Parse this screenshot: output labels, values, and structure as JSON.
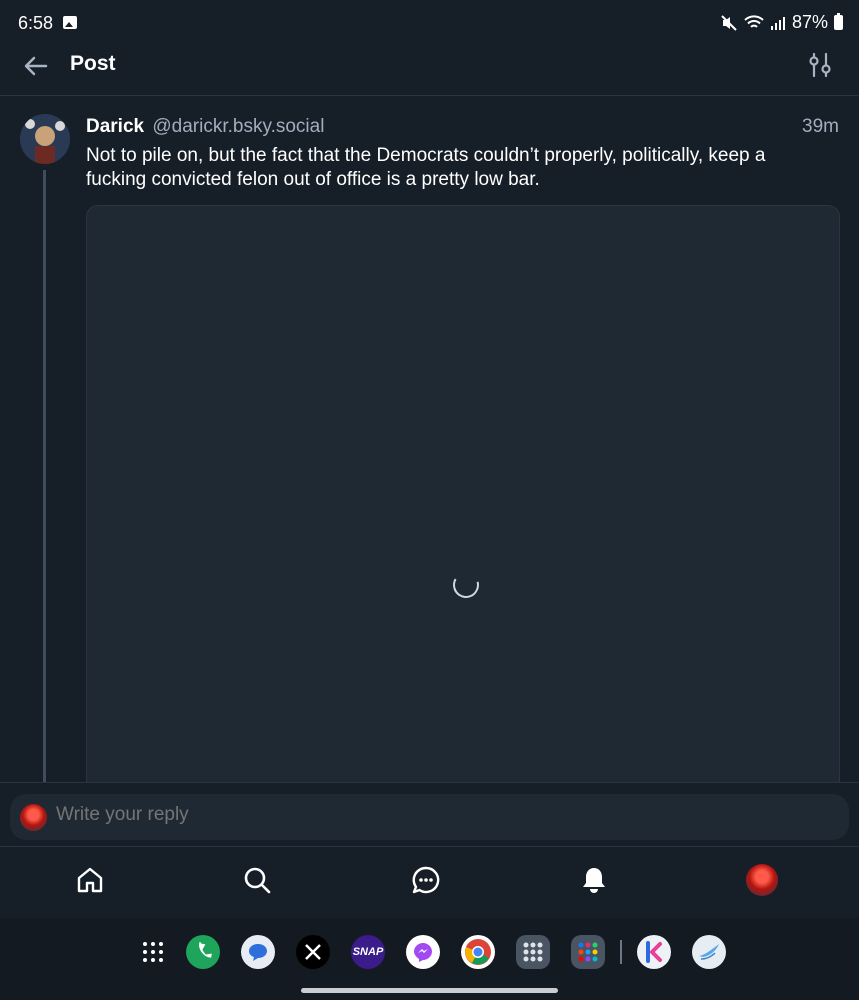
{
  "status_bar": {
    "time": "6:58",
    "battery": "87%"
  },
  "header": {
    "title": "Post"
  },
  "post": {
    "author_name": "Darick",
    "author_handle": "@darickr.bsky.social",
    "time_ago": "39m",
    "text": "Not to pile on, but the fact that the Democrats couldn’t properly, politically, keep a fucking convicted felon out of office is a pretty low bar."
  },
  "composer": {
    "placeholder": "Write your reply"
  },
  "tabbar": {
    "items": [
      "home-icon",
      "search-icon",
      "chat-icon",
      "bell-icon",
      "profile-avatar"
    ]
  },
  "dock": {
    "snap_label": "SNAP",
    "apps": [
      "app-drawer",
      "phone",
      "messages",
      "x",
      "marvel-snap",
      "messenger",
      "chrome",
      "folder",
      "folder",
      "kuesa",
      "bluesky"
    ]
  },
  "colors": {
    "background": "#161e27",
    "accent": "#208bfe",
    "muted_text": "#a1aebd"
  }
}
